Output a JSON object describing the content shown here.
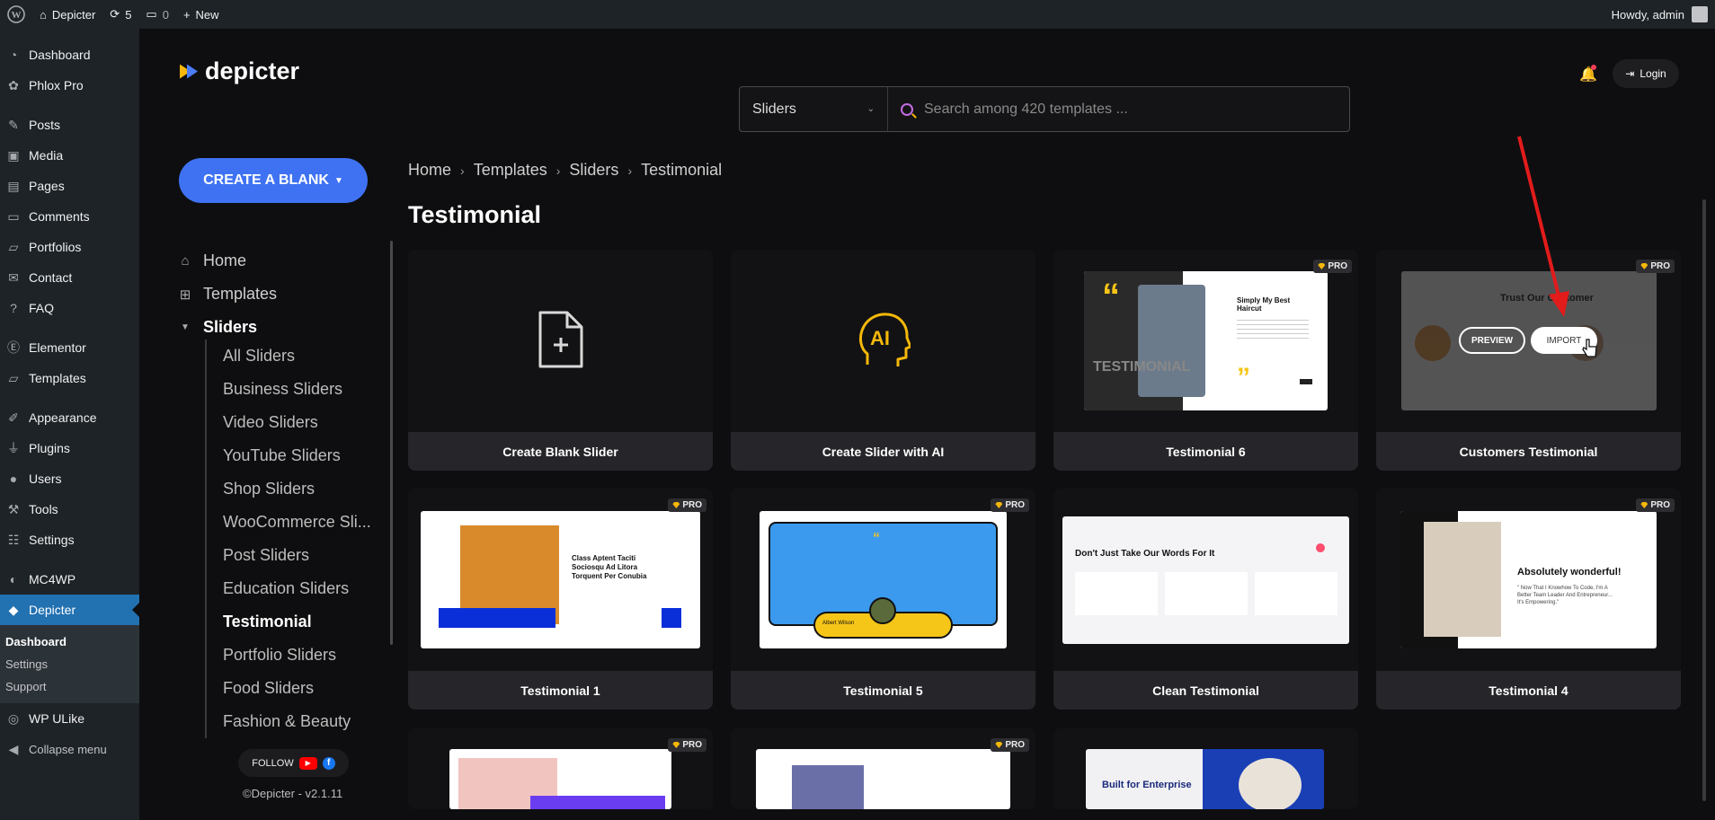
{
  "admin_bar": {
    "site_name": "Depicter",
    "updates_count": "5",
    "comments_count": "0",
    "new_label": "New",
    "howdy": "Howdy, admin"
  },
  "wp_menu": {
    "items": [
      {
        "label": "Dashboard",
        "icon": "dashboard-icon"
      },
      {
        "label": "Phlox Pro",
        "icon": "phlox-icon"
      },
      {
        "label": "Posts",
        "icon": "pin-icon"
      },
      {
        "label": "Media",
        "icon": "media-icon"
      },
      {
        "label": "Pages",
        "icon": "page-icon"
      },
      {
        "label": "Comments",
        "icon": "comment-icon"
      },
      {
        "label": "Portfolios",
        "icon": "folder-icon"
      },
      {
        "label": "Contact",
        "icon": "mail-icon"
      },
      {
        "label": "FAQ",
        "icon": "help-icon"
      },
      {
        "label": "Elementor",
        "icon": "elementor-icon"
      },
      {
        "label": "Templates",
        "icon": "folder-icon"
      },
      {
        "label": "Appearance",
        "icon": "brush-icon"
      },
      {
        "label": "Plugins",
        "icon": "plug-icon"
      },
      {
        "label": "Users",
        "icon": "user-icon"
      },
      {
        "label": "Tools",
        "icon": "wrench-icon"
      },
      {
        "label": "Settings",
        "icon": "settings-icon"
      },
      {
        "label": "MC4WP",
        "icon": "mc4wp-icon"
      },
      {
        "label": "Depicter",
        "icon": "depicter-icon"
      }
    ],
    "submenu": [
      "Dashboard",
      "Settings",
      "Support"
    ],
    "extra": [
      {
        "label": "WP ULike",
        "icon": "like-icon"
      },
      {
        "label": "Collapse menu",
        "icon": "collapse-icon"
      }
    ]
  },
  "depicter": {
    "logo_text": "depicter",
    "create_button": "CREATE A BLANK",
    "nav": {
      "home": "Home",
      "templates": "Templates",
      "sliders": "Sliders",
      "sub": [
        "All Sliders",
        "Business Sliders",
        "Video Sliders",
        "YouTube Sliders",
        "Shop Sliders",
        "WooCommerce Sli...",
        "Post Sliders",
        "Education Sliders",
        "Testimonial",
        "Portfolio Sliders",
        "Food Sliders",
        "Fashion & Beauty"
      ]
    },
    "follow_label": "FOLLOW",
    "copyright": "©Depicter - v2.1.11",
    "login_label": "Login"
  },
  "search": {
    "category": "Sliders",
    "placeholder": "Search among 420 templates ..."
  },
  "breadcrumb": [
    "Home",
    "Templates",
    "Sliders",
    "Testimonial"
  ],
  "page_title": "Testimonial",
  "cards": {
    "blank": "Create Blank Slider",
    "ai": "Create Slider with AI",
    "ai_mark": "AI",
    "t6": "Testimonial 6",
    "customers": "Customers Testimonial",
    "t1": "Testimonial 1",
    "t5": "Testimonial 5",
    "clean": "Clean Testimonial",
    "t4": "Testimonial 4",
    "pro_badge": "PRO",
    "preview_btn": "PREVIEW",
    "import_btn": "IMPORT",
    "thumb_texts": {
      "t6_heading": "Simply My Best Haircut",
      "t6_watermark": "TESTIMONIAL",
      "cust_heading": "Trust Our Customer",
      "t1_heading": "Class Aptent Taciti Sociosqu Ad Litora Torquent Per Conubia",
      "t5_name": "Albert Wilson",
      "clean_heading": "Don't Just Take Our Words For It",
      "t4_heading": "Absolutely wonderful!",
      "t4_quote": "\" Now That I Knowhow To Code, I'm A Better Team Leader And Entrepreneur... It's Empowering.\"",
      "row3_heading": "Built for Enterprise"
    }
  }
}
